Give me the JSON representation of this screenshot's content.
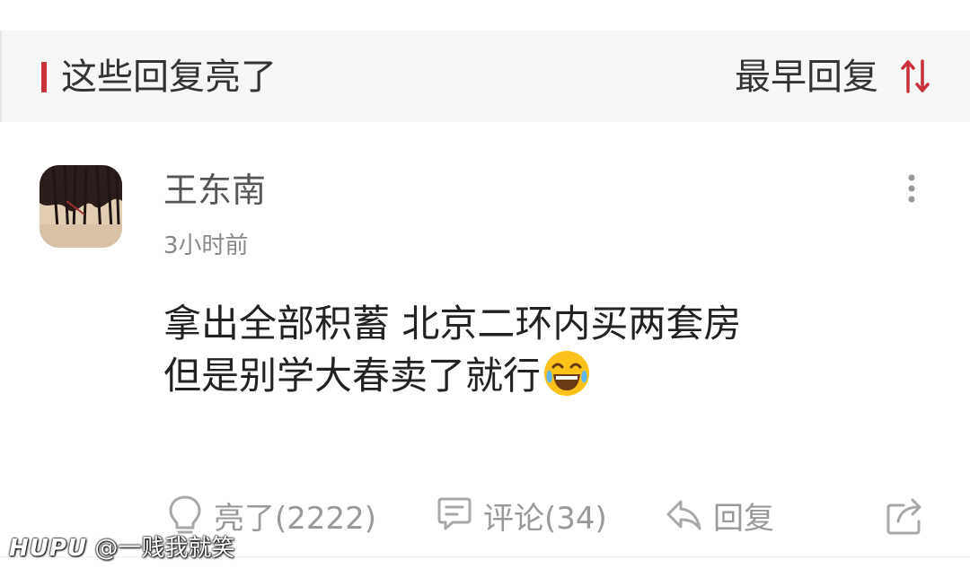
{
  "section": {
    "title": "这些回复亮了",
    "sort_label": "最早回复",
    "sort_icon": "sort-arrows-icon",
    "accent_color": "#c8303b"
  },
  "comment": {
    "username": "王东南",
    "time": "3小时前",
    "content_lines": [
      "拿出全部积蓄 北京二环内买两套房",
      "但是别学大春卖了就行"
    ],
    "emoji": "face-with-tears-of-joy",
    "actions": {
      "light": "亮了(2222)",
      "comment": "评论(34)",
      "reply": "回复"
    }
  },
  "watermark": {
    "brand": "HUPU",
    "handle": "@一贱我就笑"
  }
}
